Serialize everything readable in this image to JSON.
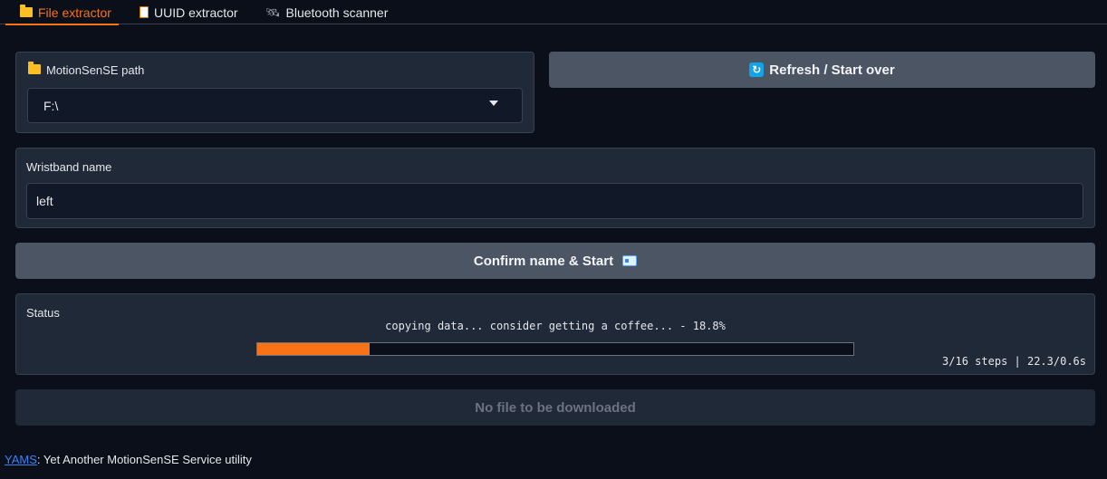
{
  "tabs": [
    {
      "label": "File extractor",
      "icon": "folder-icon",
      "active": true
    },
    {
      "label": "UUID extractor",
      "icon": "document-icon",
      "active": false
    },
    {
      "label": "Bluetooth scanner",
      "icon": "satellite-icon",
      "active": false
    }
  ],
  "path_panel": {
    "label": "MotionSenSE path",
    "value": "F:\\"
  },
  "refresh_button": {
    "label": "Refresh / Start over",
    "icon": "refresh-icon"
  },
  "wristband_panel": {
    "label": "Wristband name",
    "value": "left"
  },
  "confirm_button": {
    "label": "Confirm name & Start",
    "icon": "id-card-icon"
  },
  "status_panel": {
    "label": "Status",
    "message": "copying data... consider getting a coffee... - 18.8%",
    "progress": 0.188,
    "steps_text": "3/16 steps | 22.3/0.6s"
  },
  "download_button": {
    "label": "No file to be downloaded"
  },
  "footer": {
    "link_text": "YAMS",
    "text": ": Yet Another MotionSenSE Service utility"
  },
  "colors": {
    "accent": "#f97316",
    "background": "#0b0f19",
    "panel": "#1f2937",
    "button": "#4b5563",
    "link": "#3b82f6"
  }
}
